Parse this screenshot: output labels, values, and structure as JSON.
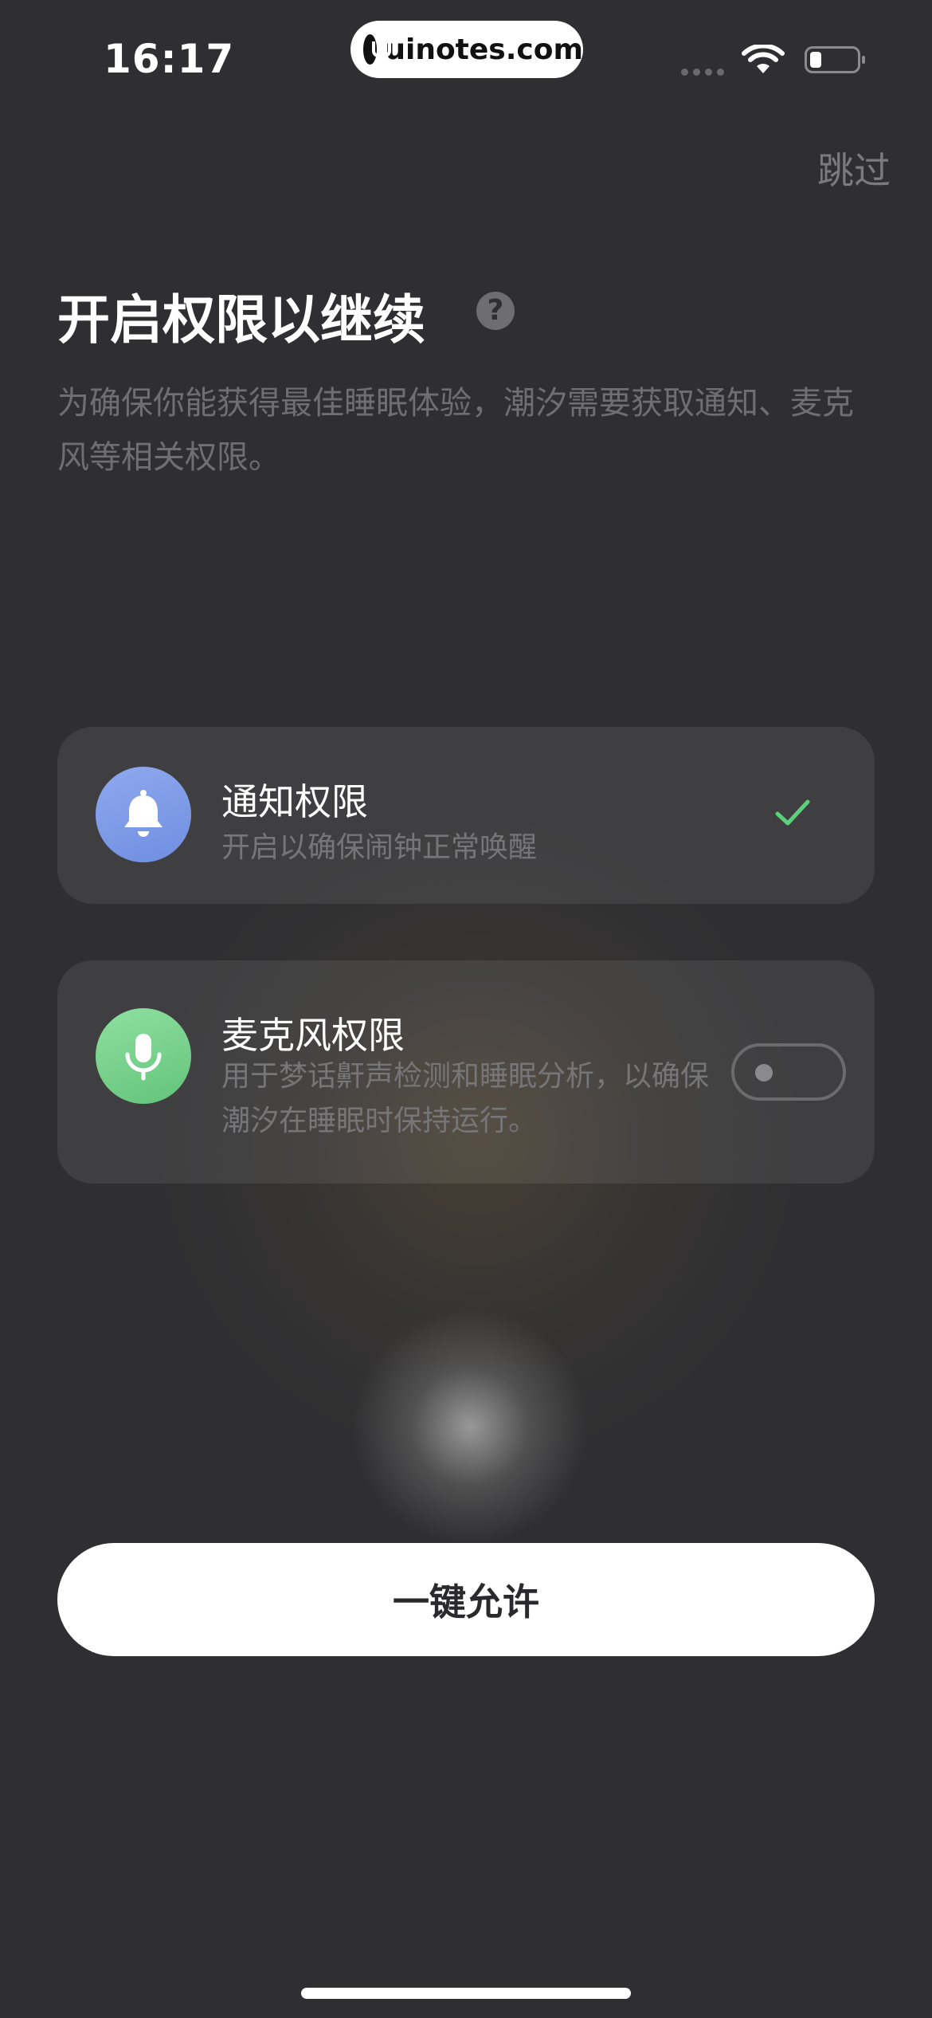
{
  "status_bar": {
    "time": "16:17",
    "watermark": "uinotes.com",
    "icons": [
      "cellular-signal-icon",
      "wifi-icon",
      "battery-icon"
    ]
  },
  "header": {
    "skip_label": "跳过",
    "title": "开启权限以继续",
    "help_icon": "?",
    "subtitle": "为确保你能获得最佳睡眠体验，潮汐需要获取通知、麦克风等相关权限。"
  },
  "permissions": [
    {
      "title": "通知权限",
      "description": "开启以确保闹钟正常唤醒",
      "icon": "bell-icon",
      "accent": "#7b98e6",
      "state": "granted",
      "state_icon": "checkmark-icon"
    },
    {
      "title": "麦克风权限",
      "description": "用于梦话鼾声检测和睡眠分析，以确保潮汐在睡眠时保持运行。",
      "icon": "microphone-icon",
      "accent": "#72cf87",
      "state": "off",
      "state_icon": "toggle-switch"
    }
  ],
  "actions": {
    "allow_all_label": "一键允许"
  },
  "colors": {
    "background": "#2f2f31",
    "check": "#5bd07a",
    "button": "#ffffff"
  }
}
